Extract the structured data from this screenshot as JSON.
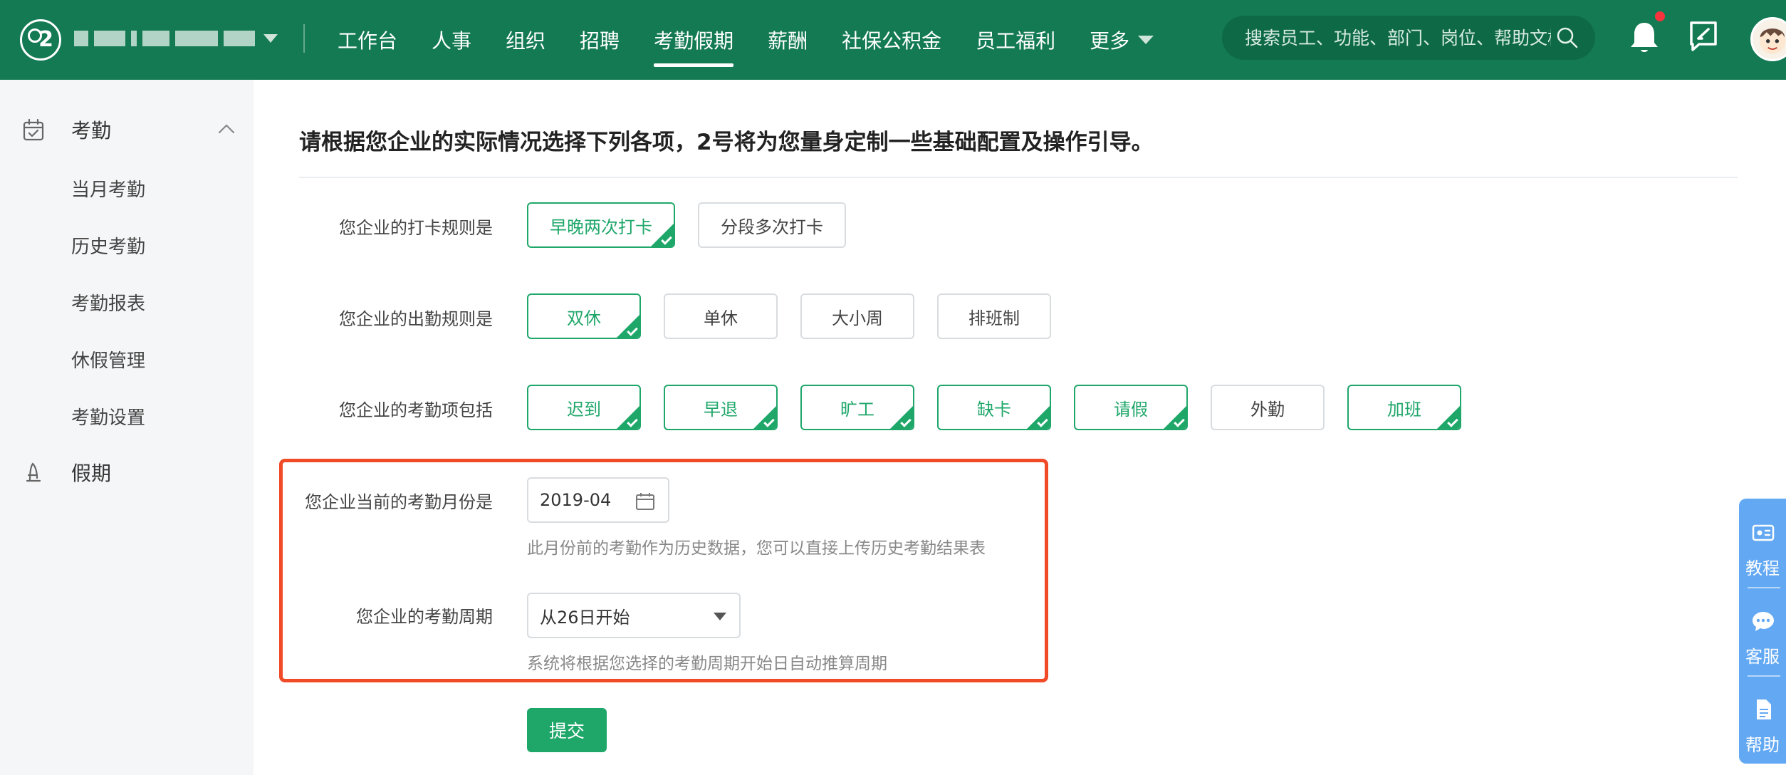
{
  "header": {
    "company_name_blurred": true,
    "nav": [
      {
        "label": "工作台"
      },
      {
        "label": "人事"
      },
      {
        "label": "组织"
      },
      {
        "label": "招聘"
      },
      {
        "label": "考勤假期",
        "active": true
      },
      {
        "label": "薪酬"
      },
      {
        "label": "社保公积金"
      },
      {
        "label": "员工福利"
      },
      {
        "label": "更多"
      }
    ],
    "search_placeholder": "搜索员工、功能、部门、岗位、帮助文档",
    "icons": [
      "search-icon",
      "bell-icon",
      "feedback-icon",
      "avatar"
    ],
    "notification_dot": true
  },
  "sidebar": {
    "groups": [
      {
        "label": "考勤",
        "icon": "calendar-check-icon",
        "expanded": true,
        "items": [
          "当月考勤",
          "历史考勤",
          "考勤报表",
          "休假管理",
          "考勤设置"
        ]
      },
      {
        "label": "假期",
        "icon": "beach-umbrella-icon"
      }
    ]
  },
  "main": {
    "title": "请根据您企业的实际情况选择下列各项，2号将为您量身定制一些基础配置及操作引导。",
    "punch_rule": {
      "label": "您企业的打卡规则是",
      "options": [
        {
          "text": "早晚两次打卡",
          "selected": true
        },
        {
          "text": "分段多次打卡",
          "selected": false
        }
      ]
    },
    "attendance_rule": {
      "label": "您企业的出勤规则是",
      "options": [
        {
          "text": "双休",
          "selected": true
        },
        {
          "text": "单休",
          "selected": false
        },
        {
          "text": "大小周",
          "selected": false
        },
        {
          "text": "排班制",
          "selected": false
        }
      ]
    },
    "attendance_items": {
      "label": "您企业的考勤项包括",
      "options": [
        {
          "text": "迟到",
          "selected": true
        },
        {
          "text": "早退",
          "selected": true
        },
        {
          "text": "旷工",
          "selected": true
        },
        {
          "text": "缺卡",
          "selected": true
        },
        {
          "text": "请假",
          "selected": true
        },
        {
          "text": "外勤",
          "selected": false
        },
        {
          "text": "加班",
          "selected": true
        }
      ]
    },
    "current_month": {
      "label": "您企业当前的考勤月份是",
      "value": "2019-04",
      "hint": "此月份前的考勤作为历史数据，您可以直接上传历史考勤结果表"
    },
    "cycle": {
      "label": "您企业的考勤周期",
      "value": "从26日开始",
      "hint": "系统将根据您选择的考勤周期开始日自动推算周期"
    },
    "submit_label": "提交"
  },
  "float_panel": {
    "items": [
      {
        "label": "教程",
        "icon": "tutorial-icon"
      },
      {
        "label": "客服",
        "icon": "chat-icon"
      },
      {
        "label": "帮助",
        "icon": "document-icon"
      }
    ]
  },
  "colors": {
    "header_bg": "#137a53",
    "accent": "#1fa76a",
    "highlight_border": "#f04a27",
    "float_panel": "#63a8f2"
  }
}
